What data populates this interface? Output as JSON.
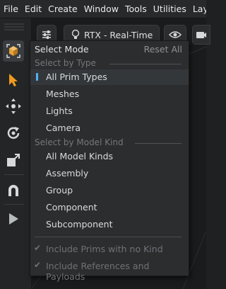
{
  "menubar": {
    "items": [
      "File",
      "Edit",
      "Create",
      "Window",
      "Tools",
      "Utilities",
      "Layouts"
    ]
  },
  "viewport_toolbar": {
    "renderer_label": "RTX - Real-Time",
    "icons": [
      "sliders-icon",
      "bulb-icon",
      "eye-icon",
      "camera-icon"
    ]
  },
  "left_toolbar": {
    "tools": [
      "select-mode-icon",
      "select-arrow-icon",
      "move-icon",
      "rotate-icon",
      "scale-icon",
      "snap-icon",
      "play-icon"
    ]
  },
  "select_mode_menu": {
    "title": "Select Mode",
    "reset_label": "Reset All",
    "section_type": "Select by Type",
    "type_items": [
      "All Prim Types",
      "Meshes",
      "Lights",
      "Camera"
    ],
    "selected_type": "All Prim Types",
    "section_kind": "Select by Model Kind",
    "kind_items": [
      "All Model Kinds",
      "Assembly",
      "Group",
      "Component",
      "Subcomponent"
    ],
    "options": [
      {
        "label": "Include Prims with no Kind",
        "checked": true
      },
      {
        "label": "Include References and Payloads",
        "checked": true
      }
    ]
  },
  "colors": {
    "accent": "#4db2ff",
    "cube_orange": "#e8a23a",
    "arrow_orange": "#f29a1e"
  }
}
